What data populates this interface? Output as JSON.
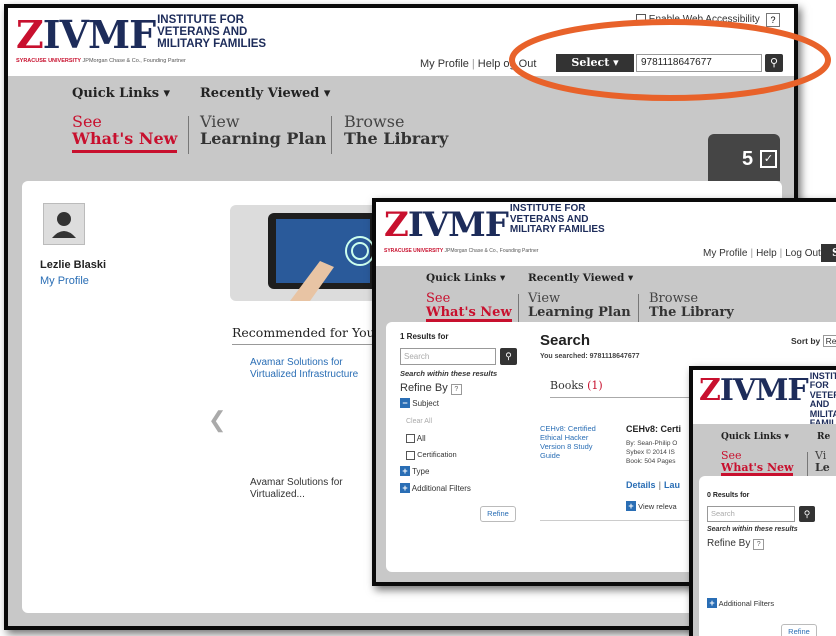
{
  "logo": {
    "mark": "IVMF",
    "line1": "INSTITUTE FOR",
    "line2": "VETERANS AND",
    "line3": "MILITARY FAMILIES",
    "su": "SYRACUSE UNIVERSITY",
    "partner": "JPMorgan Chase & Co., Founding Partner"
  },
  "accessibility": "Enable Web Accessibility",
  "help_q": "?",
  "toplinks": {
    "profile": "My Profile",
    "help": "Help",
    "logout": "Log Out",
    "logout_partial": "og Out"
  },
  "select_label": "Select ▾",
  "select_partial": "S",
  "search_value": "9781118647677",
  "nav": {
    "quick_links": "Quick Links ▾",
    "recently_viewed": "Recently Viewed ▾",
    "recently_partial": "Re",
    "tabs": [
      {
        "line1": "See",
        "line2": "What's New"
      },
      {
        "line1": "View",
        "line2": "Learning Plan"
      },
      {
        "line1": "Browse",
        "line2": "The Library"
      }
    ],
    "tab2_partial": {
      "line1": "Vi",
      "line2": "Le"
    }
  },
  "badge": {
    "count": "5",
    "icon": "checklist-icon"
  },
  "user": {
    "name": "Lezlie Blaski",
    "profile_link": "My Profile"
  },
  "recommended": {
    "heading": "Recommended for You",
    "item1": "Avamar Solutions for Virtualized Infrastructure",
    "item2": "Avamar Solutions for Virtualized..."
  },
  "search_page": {
    "results_count": "1 Results for",
    "search_placeholder": "Search",
    "search_within": "Search within these results",
    "refine_by": "Refine By",
    "subject": "Subject",
    "clear_all": "Clear All",
    "opt_all": "All",
    "opt_cert": "Certification",
    "type": "Type",
    "additional": "Additional Filters",
    "refine_btn": "Refine",
    "title": "Search",
    "you_searched": "You searched: 9781118647677",
    "books_label": "Books",
    "books_count": "(1)",
    "sort_by": "Sort by",
    "sort_partial": "Re",
    "book_thumb_text": "CEHv8: Certified Ethical Hacker Version 8 Study Guide",
    "book_title": "CEHv8: Certi",
    "book_by": "By: Sean-Philip O",
    "book_pub": "Sybex © 2014  IS",
    "book_pages": "Book: 504 Pages",
    "details": "Details",
    "launch": "Lau",
    "view_relevant": "View releva"
  },
  "search_page2": {
    "results_count": "0 Results for",
    "search_placeholder": "Search",
    "search_within": "Search within these results",
    "refine_by": "Refine By",
    "additional": "Additional Filters",
    "refine_btn": "Refine"
  },
  "colors": {
    "red": "#c8102e",
    "navy": "#1d2c5a",
    "link": "#2a6eb5",
    "band": "#c8c8c8",
    "annotation": "#e8622a"
  }
}
